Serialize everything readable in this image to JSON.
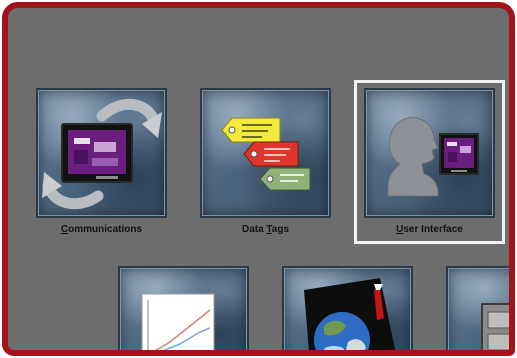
{
  "colors": {
    "frame_border": "#a4121a",
    "panel_background": "#6d6d6d",
    "tile_blue": "#4d6680",
    "selection_outline": "#f2f2f2"
  },
  "tiles": [
    {
      "label_prefix": "",
      "label_ul": "C",
      "label_suffix": "ommunications",
      "icon": "communications-icon"
    },
    {
      "label_prefix": "Data ",
      "label_ul": "T",
      "label_suffix": "ags",
      "icon": "data-tags-icon"
    },
    {
      "label_prefix": "",
      "label_ul": "U",
      "label_suffix": "ser Interface",
      "icon": "user-interface-icon",
      "selected": true
    }
  ],
  "bottom_tiles": [
    {
      "icon": "chart-icon"
    },
    {
      "icon": "globe-icon"
    },
    {
      "icon": "cabinet-icon"
    }
  ]
}
